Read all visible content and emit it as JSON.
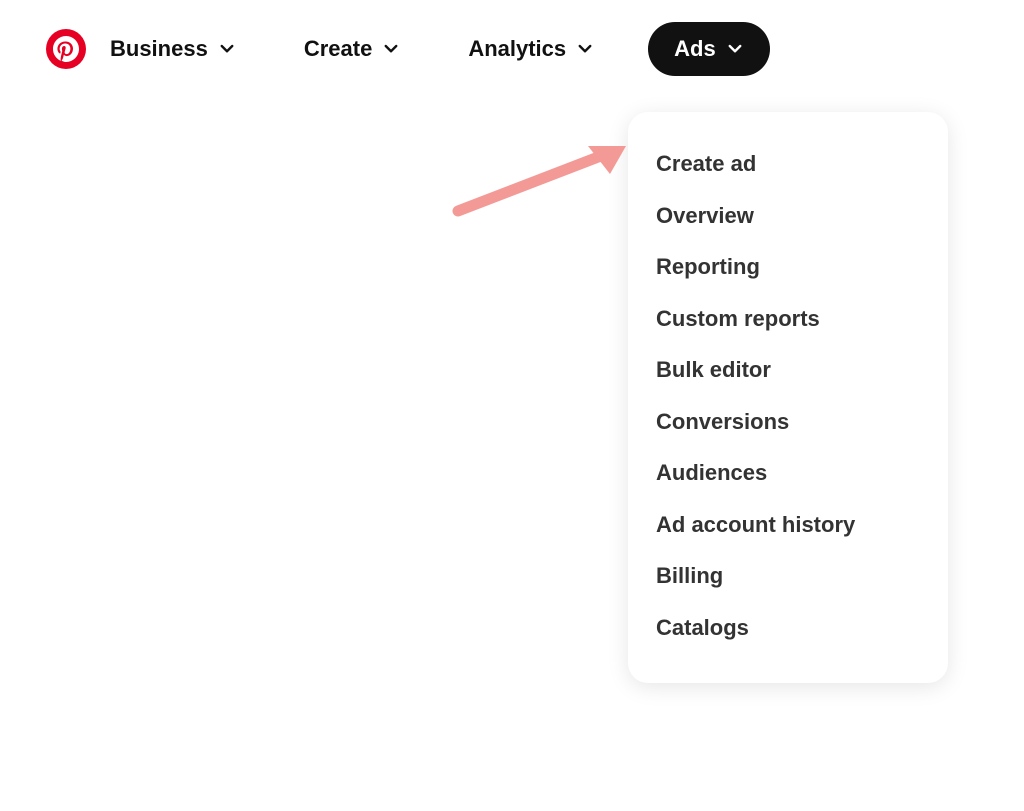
{
  "colors": {
    "brand_red": "#e60023",
    "nav_black": "#111111",
    "arrow_pink": "#f39a97"
  },
  "nav": {
    "items": [
      {
        "label": "Business",
        "active": false
      },
      {
        "label": "Create",
        "active": false
      },
      {
        "label": "Analytics",
        "active": false
      },
      {
        "label": "Ads",
        "active": true
      }
    ]
  },
  "ads_menu": {
    "items": [
      {
        "label": "Create ad"
      },
      {
        "label": "Overview"
      },
      {
        "label": "Reporting"
      },
      {
        "label": "Custom reports"
      },
      {
        "label": "Bulk editor"
      },
      {
        "label": "Conversions"
      },
      {
        "label": "Audiences"
      },
      {
        "label": "Ad account history"
      },
      {
        "label": "Billing"
      },
      {
        "label": "Catalogs"
      }
    ]
  }
}
